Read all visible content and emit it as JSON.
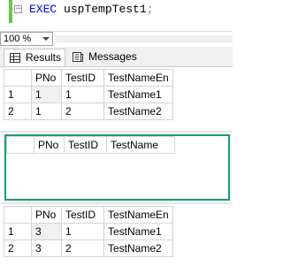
{
  "editor": {
    "keyword": "EXEC",
    "procedure": "uspTempTest1",
    "terminator": ";"
  },
  "zoom": {
    "value": "100 %"
  },
  "tabs": [
    {
      "label": "Results",
      "icon": "grid-icon"
    },
    {
      "label": "Messages",
      "icon": "messages-icon"
    }
  ],
  "grids": [
    {
      "columns": [
        "",
        "PNo",
        "TestID",
        "TestNameEn"
      ],
      "rows": [
        [
          "1",
          "1",
          "1",
          "TestName1"
        ],
        [
          "2",
          "1",
          "2",
          "TestName2"
        ]
      ]
    },
    {
      "columns": [
        "",
        "PNo",
        "TestID",
        "TestName"
      ],
      "rows": []
    },
    {
      "columns": [
        "",
        "PNo",
        "TestID",
        "TestNameEn"
      ],
      "rows": [
        [
          "1",
          "3",
          "1",
          "TestName1"
        ],
        [
          "2",
          "3",
          "2",
          "TestName2"
        ]
      ]
    }
  ],
  "colors": {
    "highlight_border": "#1a9a7e",
    "keyword": "#0000ff"
  }
}
